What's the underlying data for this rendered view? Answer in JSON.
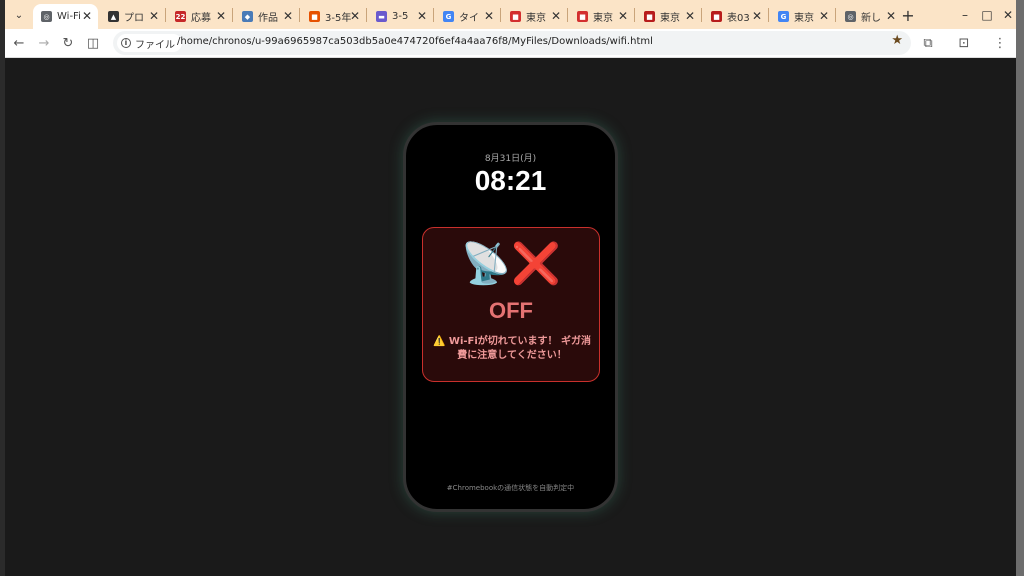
{
  "tabs": [
    {
      "title": "Wi-Fi",
      "active": true,
      "color": "#5f6368",
      "glyph": "◎"
    },
    {
      "title": "プロ",
      "active": false,
      "color": "#333333",
      "glyph": "▲"
    },
    {
      "title": "応募",
      "active": false,
      "color": "#c62828",
      "glyph": "22"
    },
    {
      "title": "作品",
      "active": false,
      "color": "#4a7bb7",
      "glyph": "◆"
    },
    {
      "title": "3-5年",
      "active": false,
      "color": "#e65100",
      "glyph": "■"
    },
    {
      "title": "3-5",
      "active": false,
      "color": "#6a5acd",
      "glyph": "▬"
    },
    {
      "title": "タイ",
      "active": false,
      "color": "#4285f4",
      "glyph": "G"
    },
    {
      "title": "東京",
      "active": false,
      "color": "#d32f2f",
      "glyph": "■"
    },
    {
      "title": "東京",
      "active": false,
      "color": "#d32f2f",
      "glyph": "■"
    },
    {
      "title": "東京",
      "active": false,
      "color": "#b71c1c",
      "glyph": "■"
    },
    {
      "title": "表03",
      "active": false,
      "color": "#b71c1c",
      "glyph": "■"
    },
    {
      "title": "東京",
      "active": false,
      "color": "#4285f4",
      "glyph": "G"
    },
    {
      "title": "新し",
      "active": false,
      "color": "#5f6368",
      "glyph": "◎"
    }
  ],
  "address_bar": {
    "chip_label": "ファイル",
    "url": "/home/chronos/u-99a6965987ca503db5a0e474720f6ef4a4aa76f8/MyFiles/Downloads/wifi.html"
  },
  "page": {
    "date": "8月31日(月)",
    "time": "08:21",
    "status_icon_left": "📡",
    "status_icon_right": "❌",
    "status": "OFF",
    "warning": "⚠️ Wi-Fiが切れています！ ギガ消費に注意してください！",
    "footer": "#Chromebookの通信状態を自動判定中"
  },
  "colors": {
    "tabbar": "#fbe4c7",
    "card_border": "#c9302c",
    "status_text": "#e57373"
  }
}
